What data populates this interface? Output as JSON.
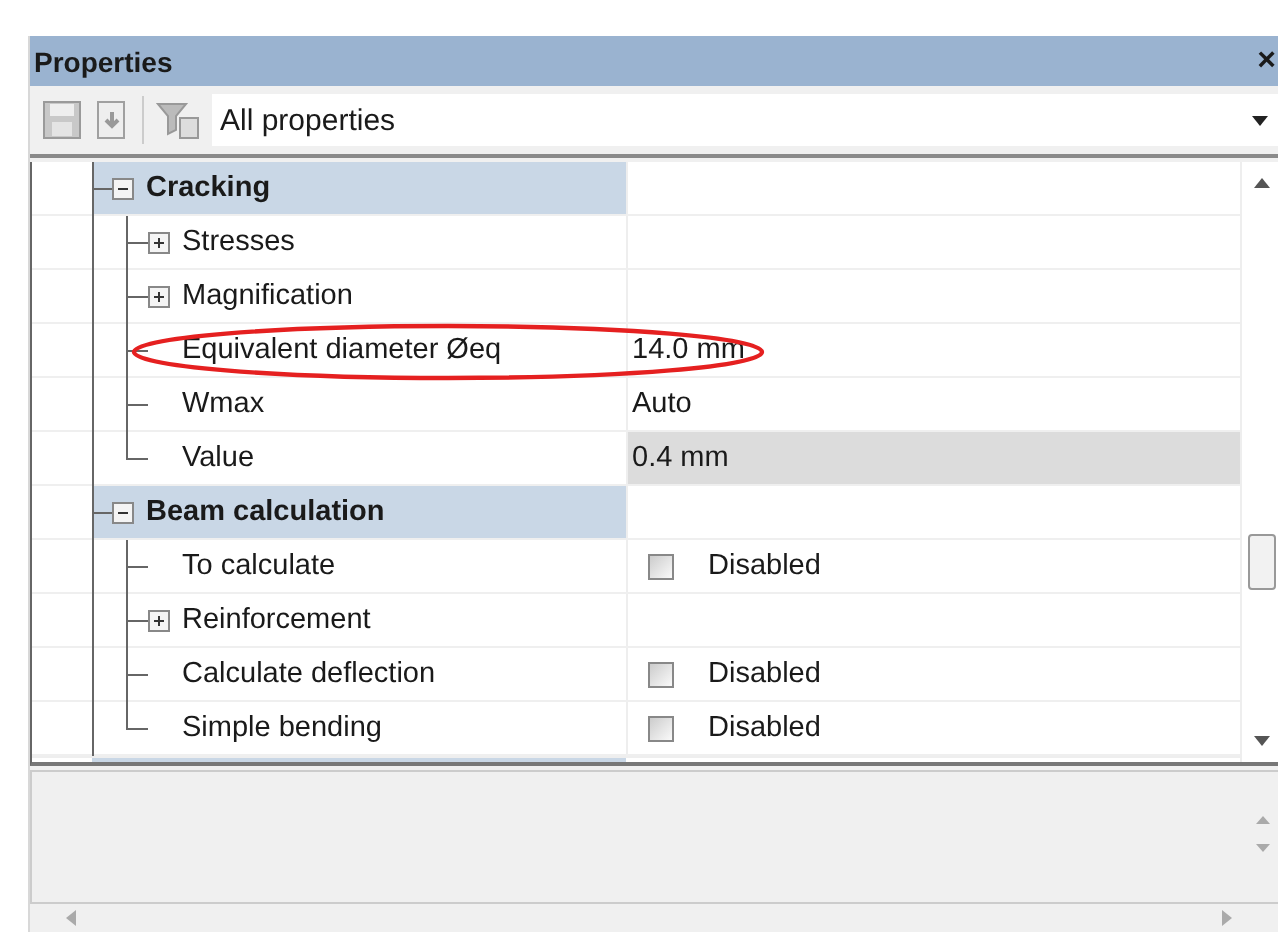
{
  "panel": {
    "title": "Properties",
    "close": "×"
  },
  "toolbar": {
    "filter": "All properties"
  },
  "tree": [
    {
      "kind": "group",
      "name": "Cracking",
      "expanded": true,
      "selected": false,
      "children": [
        {
          "kind": "item",
          "name": "Stresses",
          "expanded": false,
          "selected": false
        },
        {
          "kind": "item",
          "name": "Magnification",
          "expanded": false,
          "selected": false
        },
        {
          "kind": "item",
          "name": "Equivalent diameter Øeq",
          "value": "14.0 mm",
          "selected": false,
          "circled": true
        },
        {
          "kind": "item",
          "name": "Wmax",
          "value": "Auto",
          "selected": false
        },
        {
          "kind": "item",
          "name": "Value",
          "value": "0.4 mm",
          "selected": true
        }
      ]
    },
    {
      "kind": "group",
      "name": "Beam calculation",
      "expanded": true,
      "selected": false,
      "children": [
        {
          "kind": "check",
          "name": "To calculate",
          "value": "Disabled",
          "checked": false,
          "selected": false
        },
        {
          "kind": "item",
          "name": "Reinforcement",
          "expanded": false,
          "selected": false
        },
        {
          "kind": "check",
          "name": "Calculate deflection",
          "value": "Disabled",
          "checked": false,
          "selected": false
        },
        {
          "kind": "check",
          "name": "Simple bending",
          "value": "Disabled",
          "checked": false,
          "selected": false
        }
      ]
    }
  ]
}
